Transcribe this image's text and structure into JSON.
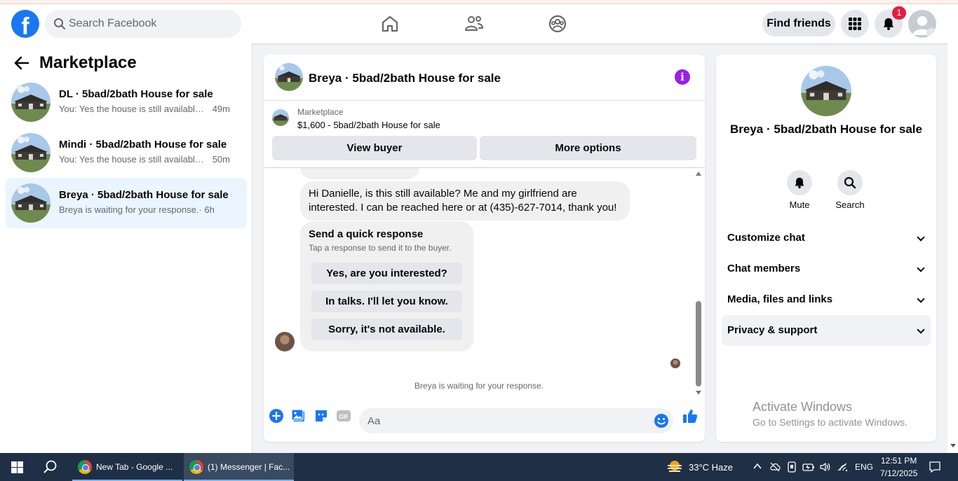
{
  "header": {
    "logo": "f",
    "search_placeholder": "Search Facebook",
    "find_friends": "Find friends",
    "notification_count": "1",
    "nav_icons": [
      "home-icon",
      "friends-icon",
      "groups-icon"
    ]
  },
  "sidebar": {
    "title": "Marketplace",
    "conversations": [
      {
        "title": "DL · 5bad/2bath House for sale",
        "preview": "You: Yes the house is still available f...",
        "time": "49m"
      },
      {
        "title": "Mindi · 5bad/2bath House for sale",
        "preview": "You: Yes the house is still available f...",
        "time": "50m"
      },
      {
        "title": "Breya · 5bad/2bath House for sale",
        "preview": "Breya is waiting for your response.",
        "time": "· 6h"
      }
    ]
  },
  "chat": {
    "title": "Breya · 5bad/2bath House for sale",
    "marketplace_label": "Marketplace",
    "listing": "$1,600 - 5bad/2bath House for sale",
    "view_buyer": "View buyer",
    "more_options": "More options",
    "message": "Hi Danielle, is this still available? Me and my girlfriend are interested. I can be reached here or at (435)-627-7014, thank you!",
    "quick_response_title": "Send a quick response",
    "quick_response_sub": "Tap a response to send it to the buyer.",
    "quick_responses": [
      "Yes, are you interested?",
      "In talks. I'll let you know.",
      "Sorry, it's not available."
    ],
    "waiting": "Breya is waiting for your response.",
    "composer_placeholder": "Aa",
    "gif_label": "GIF"
  },
  "details": {
    "title": "Breya · 5bad/2bath House for sale",
    "mute": "Mute",
    "search": "Search",
    "sections": [
      "Customize chat",
      "Chat members",
      "Media, files and links",
      "Privacy & support"
    ]
  },
  "watermark": {
    "line1": "Activate Windows",
    "line2": "Go to Settings to activate Windows."
  },
  "taskbar": {
    "apps": [
      {
        "label": "New Tab - Google ..."
      },
      {
        "label": "(1) Messenger | Fac..."
      }
    ],
    "weather": "33°C  Haze",
    "lang": "ENG",
    "time": "12:51 PM",
    "date": "7/12/2025"
  },
  "colors": {
    "facebook_blue": "#1877f2",
    "active_conv_bg": "#ebf5ff",
    "info_purple": "#9b1fe8",
    "badge_red": "#e41e3f",
    "taskbar": "#1f2f45"
  }
}
